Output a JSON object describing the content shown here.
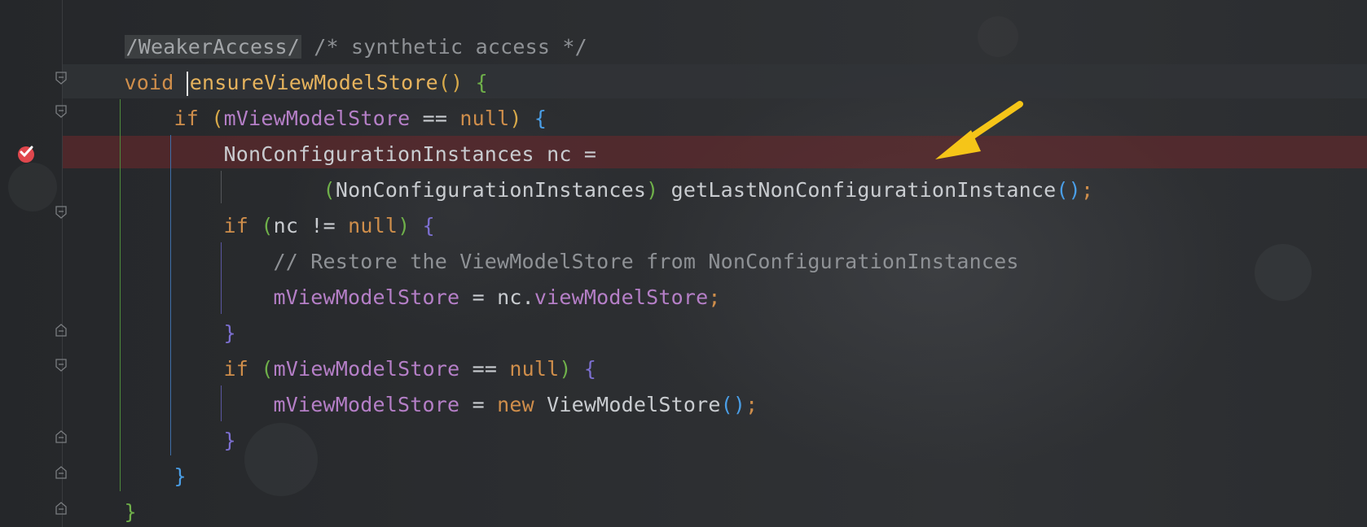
{
  "colors": {
    "keyword": "#cf8e4b",
    "method": "#e6b35d",
    "field": "#b57fc7",
    "comment": "#8f9296",
    "plain": "#c9ccd0",
    "breakpoint": "#e0474d",
    "breakpoint_line": "#682c2c",
    "annotation_arrow": "#f5c518"
  },
  "gutter": {
    "breakpoint_icon": "breakpoint-verified-icon",
    "fold_icon": "fold-marker-icon"
  },
  "code": {
    "l1": {
      "annot": "/WeakerAccess/",
      "cmt": " /* synthetic access */"
    },
    "l2": {
      "kw": "void",
      "sp": " ",
      "meth": "ensureViewModelStore",
      "po": "()",
      "sp2": " ",
      "brace": "{"
    },
    "l3": {
      "indent": "    ",
      "kw": "if",
      "sp": " ",
      "po": "(",
      "fld": "mViewModelStore",
      "op": " == ",
      "kw2": "null",
      "pc": ")",
      "sp2": " ",
      "brace": "{"
    },
    "l4": {
      "indent": "        ",
      "text": "NonConfigurationInstances nc ="
    },
    "l5": {
      "indent": "                ",
      "po": "(",
      "text": "NonConfigurationInstances",
      "pc": ")",
      "text2": " getLastNonConfigurationInstance",
      "call": "()",
      "semi": ";"
    },
    "l6": {
      "indent": "        ",
      "kw": "if",
      "sp": " ",
      "po": "(",
      "text": "nc != ",
      "kw2": "null",
      "pc": ")",
      "sp2": " ",
      "brace": "{"
    },
    "l7": {
      "indent": "            ",
      "cmt": "// Restore the ViewModelStore from NonConfigurationInstances"
    },
    "l8": {
      "indent": "            ",
      "fld": "mViewModelStore",
      "text": " = nc.",
      "fld2": "viewModelStore",
      "semi": ";"
    },
    "l9": {
      "indent": "        ",
      "brace": "}"
    },
    "l10": {
      "indent": "        ",
      "kw": "if",
      "sp": " ",
      "po": "(",
      "fld": "mViewModelStore",
      "op": " == ",
      "kw2": "null",
      "pc": ")",
      "sp2": " ",
      "brace": "{"
    },
    "l11": {
      "indent": "            ",
      "fld": "mViewModelStore",
      "text": " = ",
      "kw": "new",
      "text2": " ViewModelStore",
      "call": "()",
      "semi": ";"
    },
    "l12": {
      "indent": "        ",
      "brace": "}"
    },
    "l13": {
      "indent": "    ",
      "brace": "}"
    },
    "l14": {
      "brace": "}"
    }
  }
}
